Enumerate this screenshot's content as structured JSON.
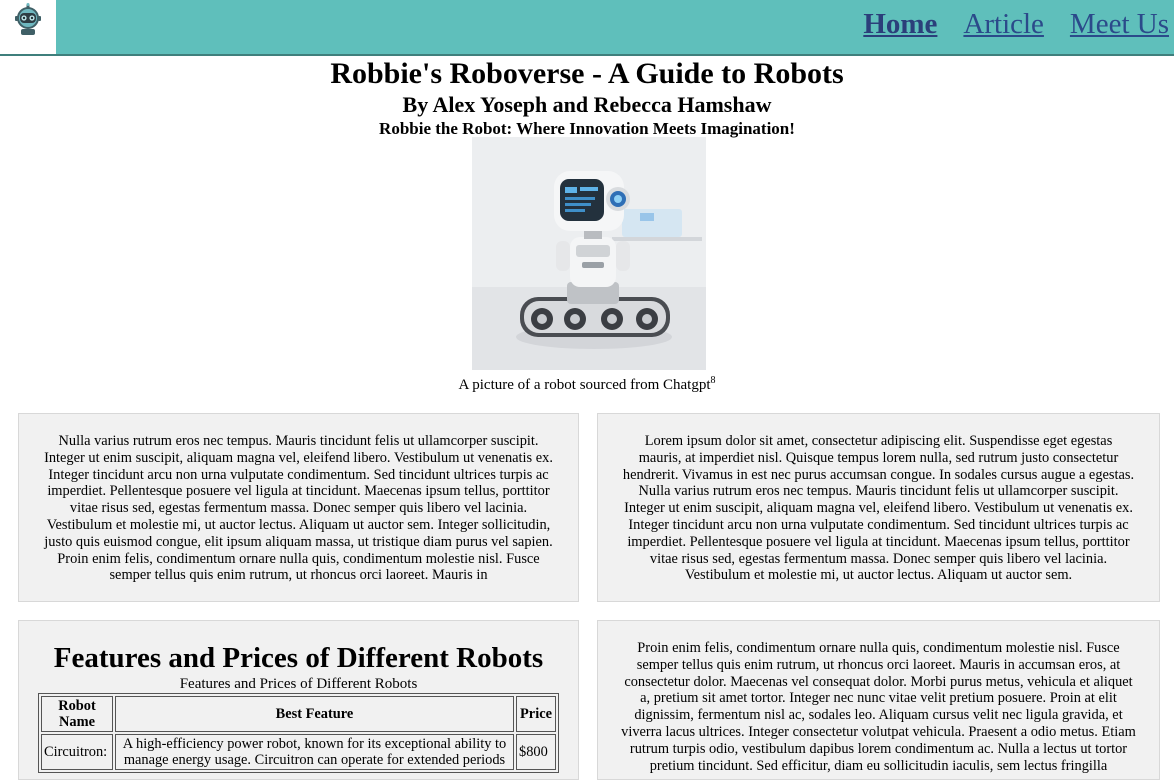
{
  "nav": {
    "links": [
      {
        "label": "Home",
        "active": true
      },
      {
        "label": "Article",
        "active": false
      },
      {
        "label": "Meet Us",
        "active": false
      }
    ]
  },
  "header": {
    "title": "Robbie's Roboverse - A Guide to Robots",
    "byline": "By Alex Yoseph and Rebecca Hamshaw",
    "tagline": "Robbie the Robot: Where Innovation Meets Imagination!"
  },
  "hero": {
    "caption": "A picture of a robot sourced from Chatgpt",
    "footnote": "8"
  },
  "cards": {
    "left_text": "Nulla varius rutrum eros nec tempus. Mauris tincidunt felis ut ullamcorper suscipit. Integer ut enim suscipit, aliquam magna vel, eleifend libero. Vestibulum ut venenatis ex. Integer tincidunt arcu non urna vulputate condimentum. Sed tincidunt ultrices turpis ac imperdiet. Pellentesque posuere vel ligula at tincidunt. Maecenas ipsum tellus, porttitor vitae risus sed, egestas fermentum massa. Donec semper quis libero vel lacinia. Vestibulum et molestie mi, ut auctor lectus. Aliquam ut auctor sem. Integer sollicitudin, justo quis euismod congue, elit ipsum aliquam massa, ut tristique diam purus vel sapien. Proin enim felis, condimentum ornare nulla quis, condimentum molestie nisl. Fusce semper tellus quis enim rutrum, ut rhoncus orci laoreet. Mauris in",
    "right_text": "Lorem ipsum dolor sit amet, consectetur adipiscing elit. Suspendisse eget egestas mauris, at imperdiet nisl. Quisque tempus lorem nulla, sed rutrum justo consectetur hendrerit. Vivamus in est nec purus accumsan congue. In sodales cursus augue a egestas. Nulla varius rutrum eros nec tempus. Mauris tincidunt felis ut ullamcorper suscipit. Integer ut enim suscipit, aliquam magna vel, eleifend libero. Vestibulum ut venenatis ex. Integer tincidunt arcu non urna vulputate condimentum. Sed tincidunt ultrices turpis ac imperdiet. Pellentesque posuere vel ligula at tincidunt. Maecenas ipsum tellus, porttitor vitae risus sed, egestas fermentum massa. Donec semper quis libero vel lacinia. Vestibulum et molestie mi, ut auctor lectus. Aliquam ut auctor sem.",
    "bottom_right_text": "Proin enim felis, condimentum ornare nulla quis, condimentum molestie nisl. Fusce semper tellus quis enim rutrum, ut rhoncus orci laoreet. Mauris in accumsan eros, at consectetur dolor. Maecenas vel consequat dolor. Morbi purus metus, vehicula et aliquet a, pretium sit amet tortor. Integer nec nunc vitae velit pretium posuere. Proin at elit dignissim, fermentum nisl ac, sodales leo. Aliquam cursus velit nec ligula gravida, et viverra lacus ultrices. Integer consectetur volutpat vehicula. Praesent a odio metus. Etiam rutrum turpis odio, vestibulum dapibus lorem condimentum ac. Nulla a lectus ut tortor pretium tincidunt. Sed efficitur, diam eu sollicitudin iaculis, sem lectus fringilla"
  },
  "table": {
    "heading": "Features and Prices of Different Robots",
    "caption": "Features and Prices of Different Robots",
    "columns": [
      "Robot Name",
      "Best Feature",
      "Price"
    ],
    "rows": [
      {
        "name": "Circuitron:",
        "feature": "A high-efficiency power robot, known for its exceptional ability to manage energy usage. Circuitron can operate for extended periods",
        "price": "$800"
      }
    ]
  },
  "colors": {
    "topbar": "#5fbfbb",
    "card_bg": "#f1f1f1",
    "link": "#2b4a8a"
  }
}
